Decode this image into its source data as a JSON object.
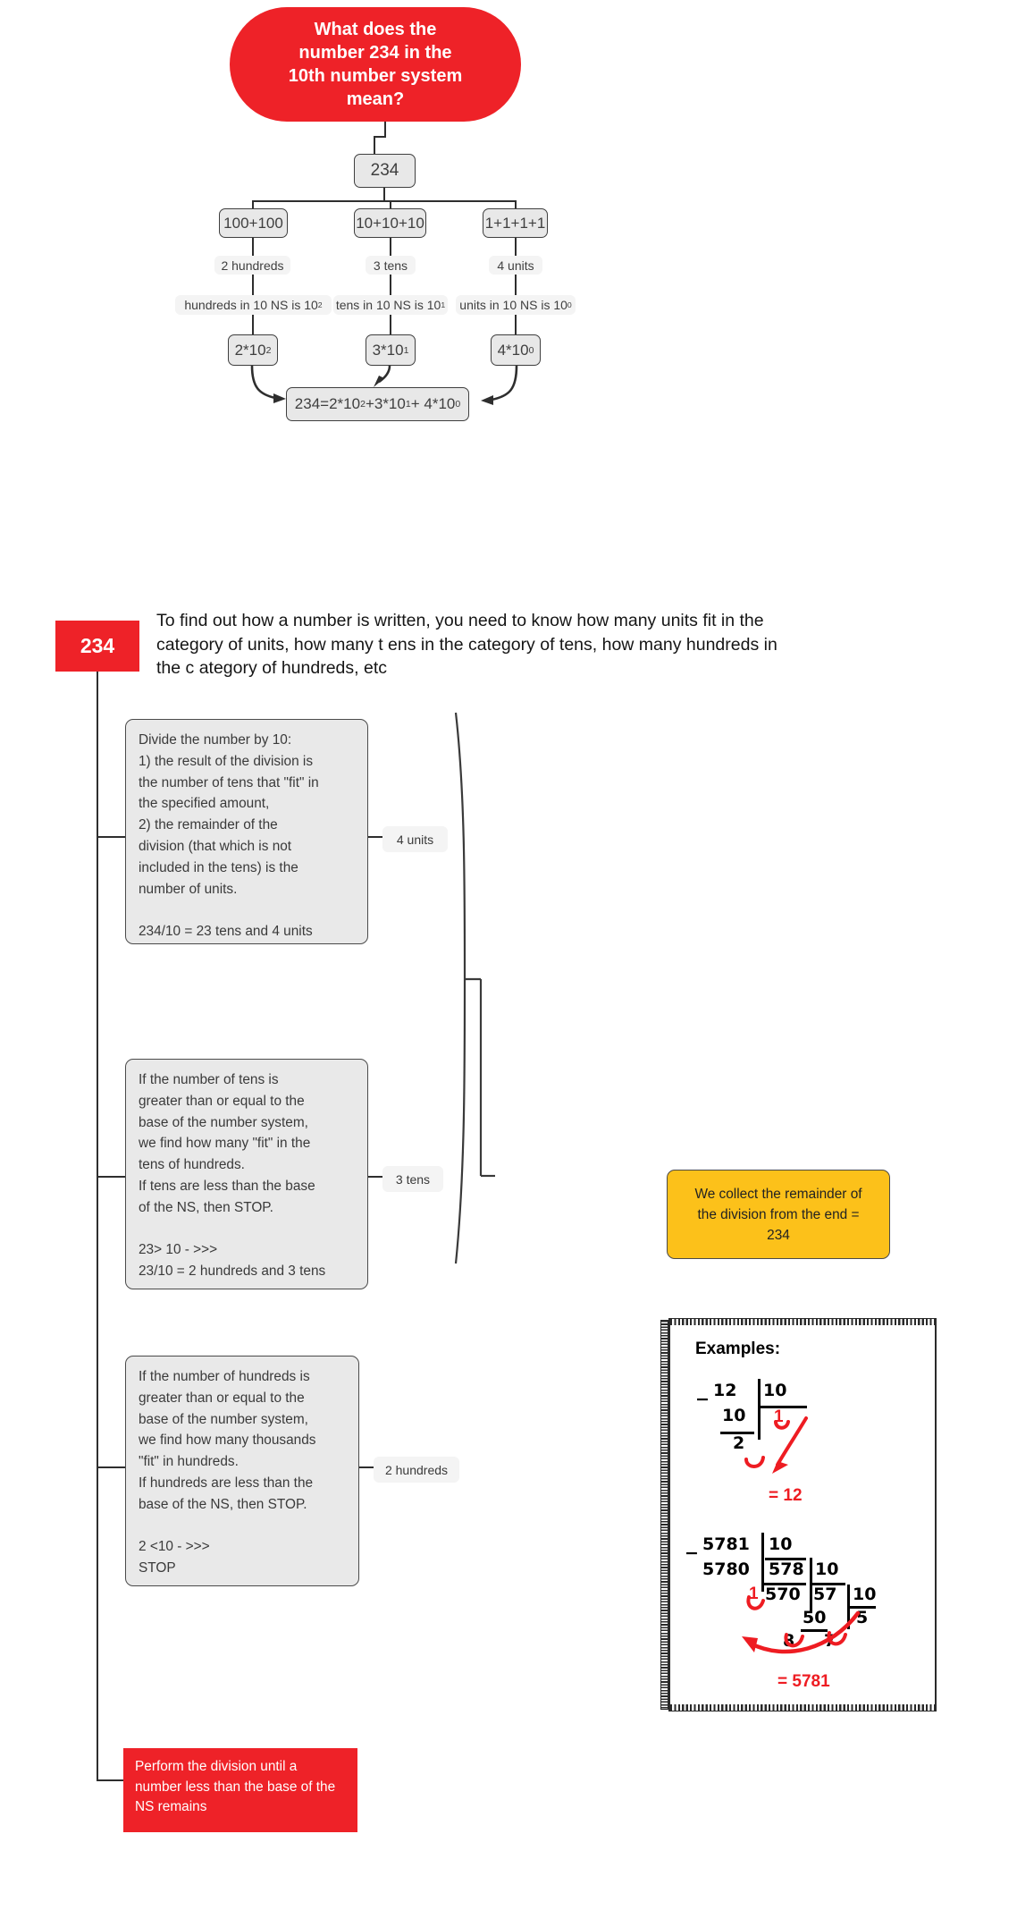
{
  "title": "What does the number 234 in the 10th number system mean?",
  "colors": {
    "red": "#ee2228",
    "yellow": "#fcc11a",
    "node_fill": "#e8e8e8",
    "node_stroke": "#3f3f3f"
  },
  "tree": {
    "root": "What does the\nnumber 234 in the\n10th number system\nmean?",
    "number": "234",
    "branches": [
      {
        "sum": "100+100",
        "count": "2 hundreds",
        "rule_prefix": "hundreds in 10 NS is 10",
        "rule_exp": "2",
        "power_base": "2*10",
        "power_exp": "2"
      },
      {
        "sum": "10+10+10",
        "count": "3 tens",
        "rule_prefix": "tens in 10 NS is 10",
        "rule_exp": "1",
        "power_base": "3*10",
        "power_exp": "1"
      },
      {
        "sum": "1+1+1+1",
        "count": "4 units",
        "rule_prefix": "units in 10 NS is 10",
        "rule_exp": "0",
        "power_base": "4*10",
        "power_exp": "0"
      }
    ],
    "equation": {
      "p1": "234=2*10",
      "e1": "2",
      "p2": "+3*10",
      "e2": "1",
      "p3": "+ 4*10",
      "e3": "0"
    }
  },
  "lower": {
    "tag": "234",
    "intro": "To find out how a number is written, you need to know how many units fit in the category of units, how many t ens in the category of tens, how many hundreds in the c ategory of hundreds, etc",
    "steps": [
      {
        "text": "Divide the number by 10:\n1) the result of the division is\nthe number of tens that \"fit\" in\nthe specified amount,\n2) the remainder of the\ndivision (that which is not\nincluded in the tens) is the\nnumber of units.\n\n234/10 = 23 tens and 4 units",
        "label": "4 units"
      },
      {
        "text": "If the number of tens is\ngreater than or equal to the\nbase of the number system,\nwe find how many \"fit\" in the\ntens of hundreds.\nIf tens are less than the base\nof the NS, then STOP.\n\n23> 10 - >>>\n23/10 = 2 hundreds and 3 tens",
        "label": "3 tens"
      },
      {
        "text": "If the number of hundreds is\ngreater than or equal to the\nbase of the number system,\nwe find how many thousands\n\"fit\" in hundreds.\nIf hundreds are less than the\nbase of the NS, then STOP.\n\n2 <10 - >>>\nSTOP",
        "label": "2 hundreds"
      }
    ],
    "red_note": "Perform the division until a number less than the base of the NS remains",
    "yellow_note": "We collect the remainder of\nthe division from the end =\n234"
  },
  "examples": {
    "title": "Examples:",
    "ex1": {
      "dividend": "12",
      "divisor": "10",
      "sub": "10",
      "quotient": "1",
      "remainder": "2",
      "result": "= 12"
    },
    "ex2": {
      "dividend": "5781",
      "divisor": "10",
      "sub": "5780",
      "rem1": "1",
      "q1": "578",
      "d2": "10",
      "sub2": "570",
      "rem2": "8",
      "q2": "57",
      "d3": "10",
      "sub3": "50",
      "rem3": "7",
      "q3": "5",
      "result": "= 5781"
    }
  }
}
